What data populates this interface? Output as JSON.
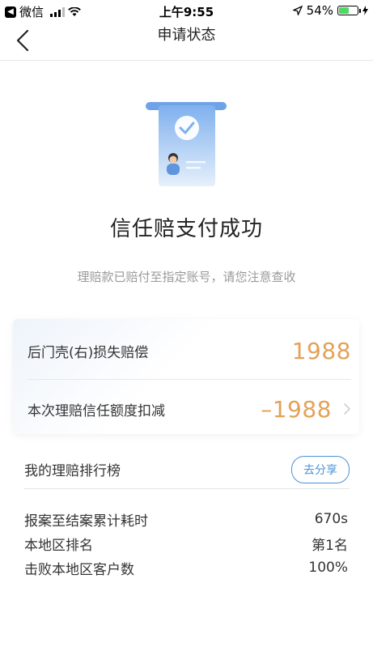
{
  "status_bar": {
    "carrier": "微信",
    "time": "上午9:55",
    "battery": "54%",
    "battery_level": 0.54
  },
  "nav": {
    "title": "申请状态",
    "back_icon": "chevron-left-icon"
  },
  "result": {
    "title": "信任赔支付成功",
    "subtitle": "理赔款已赔付至指定账号，请您注意查收"
  },
  "card": {
    "rows": [
      {
        "label": "后门壳(右)损失赔偿",
        "amount": "1988"
      },
      {
        "label": "本次理赔信任额度扣减",
        "amount": "–1988"
      }
    ]
  },
  "ranking": {
    "title": "我的理赔排行榜",
    "share_label": "去分享",
    "stats": [
      {
        "label": "报案至结案累计耗时",
        "value": "670s"
      },
      {
        "label": "本地区排名",
        "value": "第1名"
      },
      {
        "label": "击败本地区客户数",
        "value": "100%"
      }
    ]
  },
  "colors": {
    "accent_blue": "#4b92d6",
    "amount_orange": "#e3a257"
  }
}
